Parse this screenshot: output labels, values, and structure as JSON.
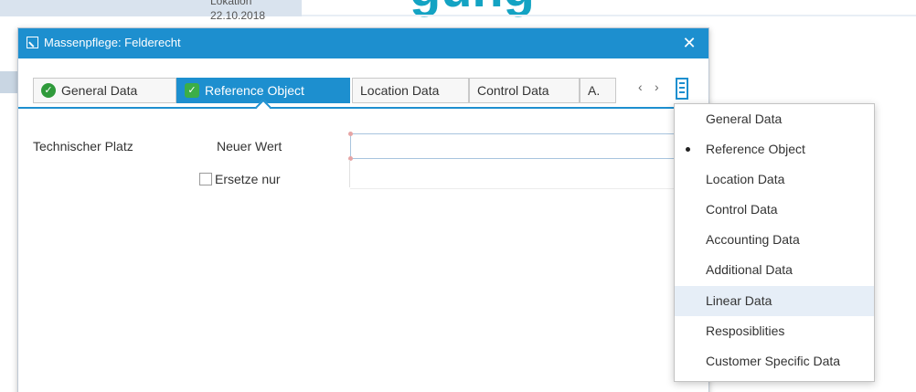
{
  "background": {
    "label": "Lokation",
    "date": "22.10.2018",
    "heading_fragment": "gung"
  },
  "dialog": {
    "title": "Massenpflege: Felderecht",
    "close_label": "✕",
    "tabs": [
      {
        "label": "General Data",
        "checked": true,
        "active": false
      },
      {
        "label": "Reference Object",
        "checked": true,
        "active": true
      },
      {
        "label": "Location Data",
        "checked": false,
        "active": false
      },
      {
        "label": "Control Data",
        "checked": false,
        "active": false
      },
      {
        "label": "A.",
        "checked": false,
        "active": false
      }
    ],
    "tab_prev": "‹",
    "tab_next": "›"
  },
  "form": {
    "field_label": "Technischer Platz",
    "new_value_label": "Neuer Wert",
    "new_value": "",
    "replace_only_label": "Ersetze nur",
    "replace_only_checked": false
  },
  "tab_menu": {
    "items": [
      {
        "label": "General Data",
        "selected": false,
        "hover": false
      },
      {
        "label": "Reference Object",
        "selected": true,
        "hover": false
      },
      {
        "label": "Location Data",
        "selected": false,
        "hover": false
      },
      {
        "label": "Control Data",
        "selected": false,
        "hover": false
      },
      {
        "label": "Accounting Data",
        "selected": false,
        "hover": false
      },
      {
        "label": "Additional Data",
        "selected": false,
        "hover": false
      },
      {
        "label": "Linear Data",
        "selected": false,
        "hover": true
      },
      {
        "label": "Resposiblities",
        "selected": false,
        "hover": false
      },
      {
        "label": "Customer Specific Data",
        "selected": false,
        "hover": false
      }
    ]
  },
  "colors": {
    "accent": "#1d8fcf",
    "check_green": "#2f9a3b",
    "heading_teal": "#13a3c3",
    "menu_hover": "#e6eef7"
  },
  "icons": {
    "title": "edit-icon",
    "close": "close-icon",
    "tab_check": "checkmark-icon",
    "tab_list": "tab-list-icon",
    "menu_selected": "bullet-icon"
  }
}
